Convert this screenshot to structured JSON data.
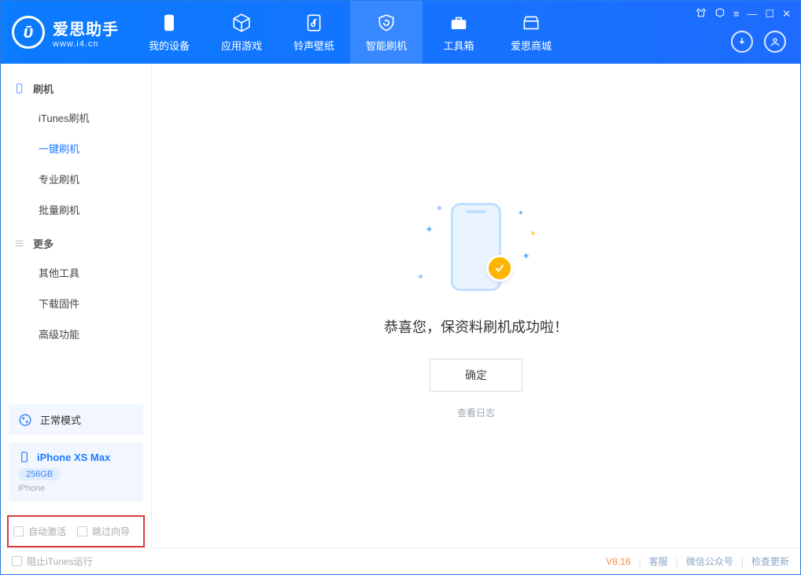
{
  "header": {
    "app_name": "爱思助手",
    "app_url": "www.i4.cn",
    "tabs": [
      {
        "label": "我的设备"
      },
      {
        "label": "应用游戏"
      },
      {
        "label": "铃声壁纸"
      },
      {
        "label": "智能刷机"
      },
      {
        "label": "工具箱"
      },
      {
        "label": "爱思商城"
      }
    ]
  },
  "sidebar": {
    "group1_title": "刷机",
    "group1_items": [
      "iTunes刷机",
      "一键刷机",
      "专业刷机",
      "批量刷机"
    ],
    "group2_title": "更多",
    "group2_items": [
      "其他工具",
      "下载固件",
      "高级功能"
    ],
    "mode_label": "正常模式",
    "device_name": "iPhone XS Max",
    "device_storage": "256GB",
    "device_type": "iPhone",
    "opt_auto_activate": "自动激活",
    "opt_skip_guide": "跳过向导"
  },
  "main": {
    "success_msg": "恭喜您，保资料刷机成功啦！",
    "ok_label": "确定",
    "log_label": "查看日志"
  },
  "footer": {
    "block_itunes": "阻止iTunes运行",
    "version": "V8.16",
    "links": [
      "客服",
      "微信公众号",
      "检查更新"
    ]
  }
}
